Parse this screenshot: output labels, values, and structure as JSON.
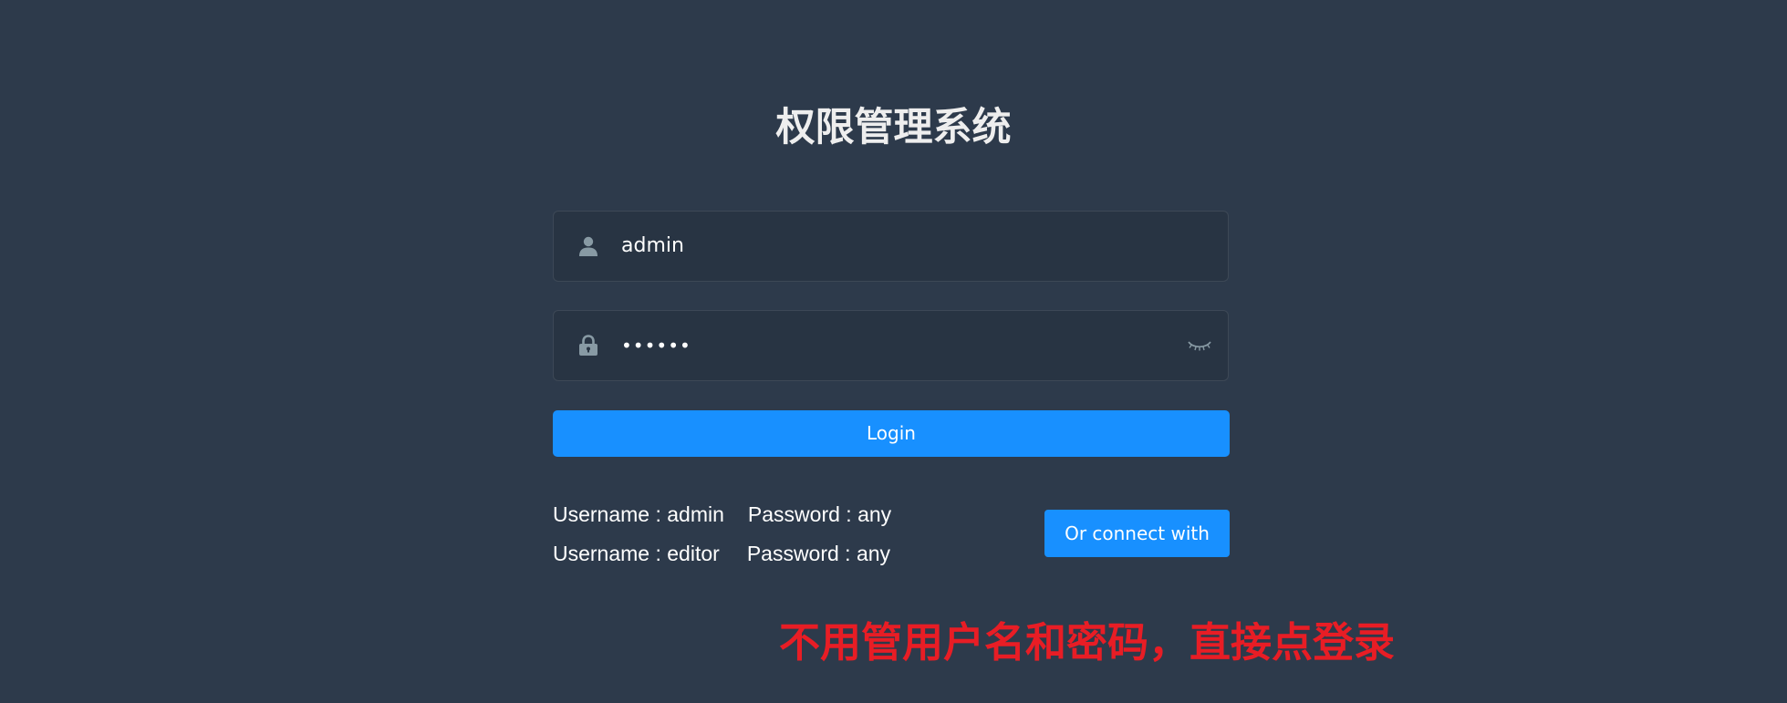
{
  "page": {
    "title": "权限管理系统"
  },
  "login_form": {
    "username": {
      "value": "admin",
      "icon": "user-icon"
    },
    "password": {
      "masked_value": "••••••",
      "icon": "lock-icon",
      "toggle_icon": "eye-closed-icon"
    },
    "login_label": "Login"
  },
  "tips": [
    {
      "username": "Username : admin",
      "password": "Password : any"
    },
    {
      "username": "Username : editor",
      "password": "Password : any"
    }
  ],
  "connect_label": "Or connect with",
  "annotation": "不用管用户名和密码，直接点登录",
  "colors": {
    "background": "#2d3a4b",
    "input_background": "#283443",
    "primary": "#1890ff",
    "annotation": "#e81d25",
    "icon": "#889aa4"
  }
}
